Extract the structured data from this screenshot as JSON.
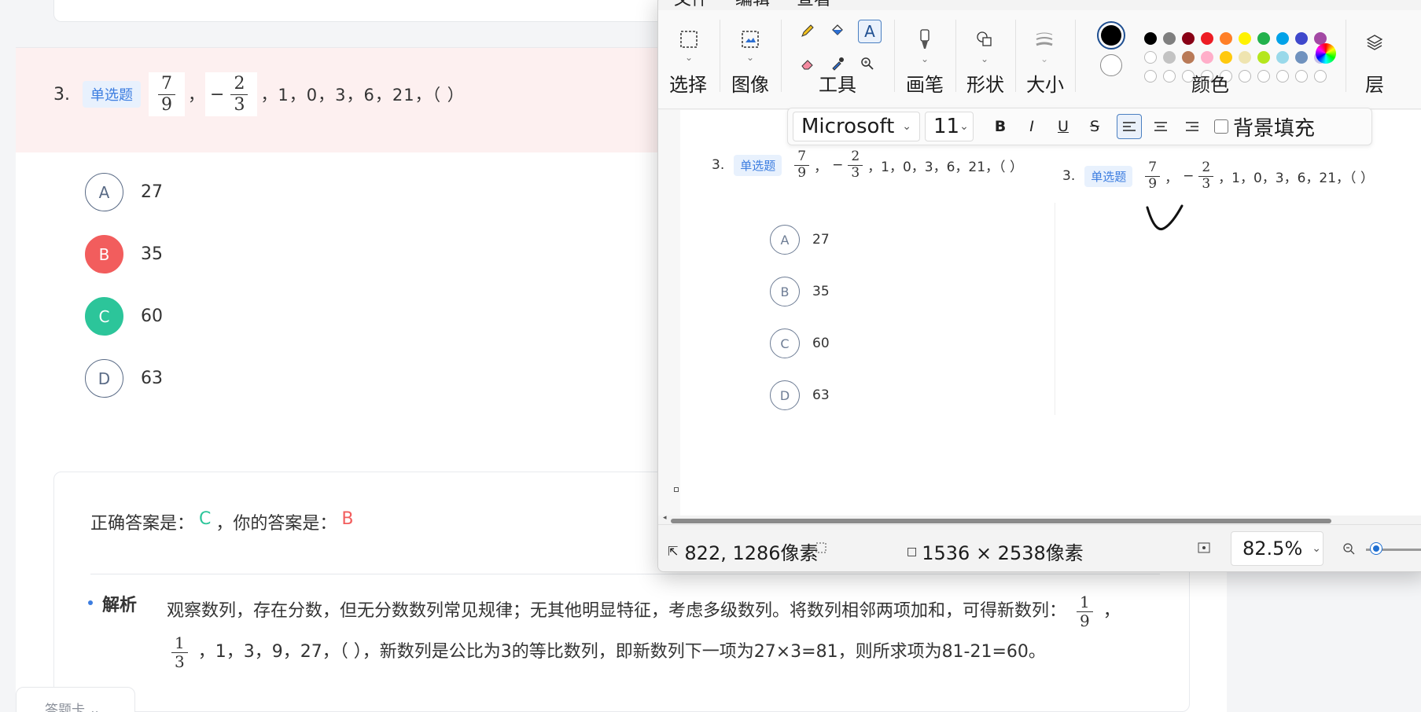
{
  "quiz": {
    "question_number": "3.",
    "question_type": "单选题",
    "frac1": {
      "num": "7",
      "den": "9"
    },
    "sep1": "，",
    "frac2_sign": "−",
    "frac2": {
      "num": "2",
      "den": "3"
    },
    "sequence_rest": "，1，0，3，6，21，（ ）",
    "options": [
      {
        "letter": "A",
        "value": "27",
        "state": "normal"
      },
      {
        "letter": "B",
        "value": "35",
        "state": "wrong"
      },
      {
        "letter": "C",
        "value": "60",
        "state": "correct"
      },
      {
        "letter": "D",
        "value": "63",
        "state": "normal"
      }
    ],
    "answer": {
      "correct_label": "正确答案是：",
      "correct_value": "C",
      "sep": "，",
      "yours_label": "你的答案是：",
      "yours_value": "B"
    },
    "analysis": {
      "label": "解析",
      "text1": "观察数列，存在分数，但无分数数列常见规律；无其他明显特征，考虑多级数列。将数列相邻两项加和，可得新数列：",
      "f1": {
        "num": "1",
        "den": "9"
      },
      "sep": "，",
      "f2": {
        "num": "1",
        "den": "3"
      },
      "text2": "，1，3，9，27，（ ），新数列是公比为3的等比数列，即新数列下一项为27×3=81，则所求项为81-21=60。"
    },
    "card_tab": "答题卡"
  },
  "paint": {
    "menu": [
      "文件",
      "编辑",
      "查看"
    ],
    "groups": {
      "select": "选择",
      "image": "图像",
      "tools": "工具",
      "brush": "画笔",
      "shapes": "形状",
      "size": "大小",
      "colors": "颜色",
      "layers": "层"
    },
    "palette": {
      "row1": [
        "#000000",
        "#7f7f7f",
        "#880015",
        "#ed1c24",
        "#ff7f27",
        "#fff200",
        "#22b14c",
        "#00a2e8",
        "#3f48cc",
        "#a349a4"
      ],
      "row2": [
        "#ffffff",
        "#c3c3c3",
        "#b97a57",
        "#ffaec9",
        "#ffc90e",
        "#efe4b0",
        "#b5e61d",
        "#99d9ea",
        "#7092be",
        "#c8bfe7"
      ],
      "primary": "#000000",
      "secondary": "#ffffff"
    },
    "text_toolbar": {
      "font": "Microsoft Ya",
      "size": "11",
      "bold": "B",
      "italic": "I",
      "underline": "U",
      "strike": "S",
      "fill_label": "背景填充"
    },
    "status": {
      "cursor": "822, 1286像素",
      "canvas_size": "1536 × 2538像素",
      "zoom": "82.5%"
    }
  }
}
